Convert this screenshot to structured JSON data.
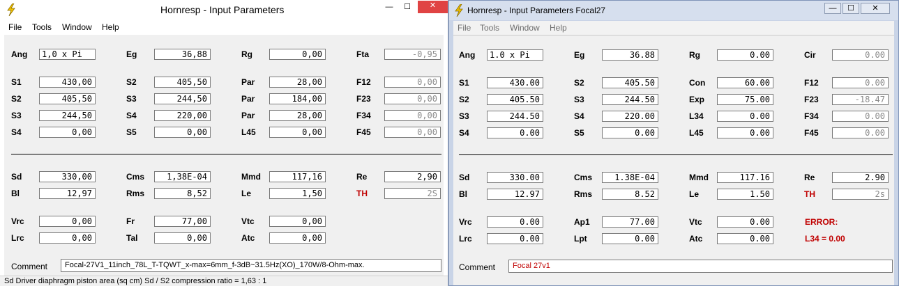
{
  "w1": {
    "title": "Hornresp - Input Parameters",
    "menu": [
      "File",
      "Tools",
      "Window",
      "Help"
    ],
    "captions": {
      "min": "—",
      "max": "☐",
      "close": "✕"
    },
    "fields": {
      "Ang": "1,0 x Pi",
      "Eg": "36,88",
      "Rg": "0,00",
      "Fta": "-0,95",
      "S1a": "430,00",
      "S2b": "405,50",
      "Par1": "28,00",
      "F12": "0,00",
      "S2a": "405,50",
      "S3b": "244,50",
      "Par2": "184,00",
      "F23": "0,00",
      "S3a": "244,50",
      "S4b": "220,00",
      "Par3": "28,00",
      "F34": "0,00",
      "S4a": "0,00",
      "S5b": "0,00",
      "L45": "0,00",
      "F45": "0,00",
      "Sd": "330,00",
      "Cms": "1,38E-04",
      "Mmd": "117,16",
      "Re": "2,90",
      "Bl": "12,97",
      "Rms": "8,52",
      "Le": "1,50",
      "TH": "2S",
      "Vrc": "0,00",
      "Fr": "77,00",
      "Vtc": "0,00",
      "Lrc": "0,00",
      "Tal": "0,00",
      "Atc": "0,00"
    },
    "labels": {
      "Ang": "Ang",
      "Eg": "Eg",
      "Rg": "Rg",
      "Fta": "Fta",
      "S1a": "S1",
      "S2b": "S2",
      "Par1": "Par",
      "F12": "F12",
      "S2a": "S2",
      "S3b": "S3",
      "Par2": "Par",
      "F23": "F23",
      "S3a": "S3",
      "S4b": "S4",
      "Par3": "Par",
      "F34": "F34",
      "S4a": "S4",
      "S5b": "S5",
      "L45": "L45",
      "F45": "F45",
      "Sd": "Sd",
      "Cms": "Cms",
      "Mmd": "Mmd",
      "Re": "Re",
      "Bl": "Bl",
      "Rms": "Rms",
      "Le": "Le",
      "TH": "TH",
      "Vrc": "Vrc",
      "Fr": "Fr",
      "Vtc": "Vtc",
      "Lrc": "Lrc",
      "Tal": "Tal",
      "Atc": "Atc"
    },
    "comment_label": "Comment",
    "comment": "Focal-27V1_11inch_78L_T-TQWT_x-max=6mm_f-3dB~31.5Hz(XO)_170W/8-Ohm-max.",
    "status": "Sd   Driver diaphragm piston area  (sq cm)   Sd / S2 compression ratio = 1,63 : 1"
  },
  "w2": {
    "title": "Hornresp - Input Parameters   Focal27",
    "menu": [
      "File",
      "Tools",
      "Window",
      "Help"
    ],
    "captions": {
      "min": "—",
      "max": "☐",
      "close": "✕"
    },
    "fields": {
      "Ang": "1.0 x Pi",
      "Eg": "36.88",
      "Rg": "0.00",
      "Cir": "0.00",
      "S1a": "430.00",
      "S2b": "405.50",
      "Con": "60.00",
      "F12": "0.00",
      "S2a": "405.50",
      "S3b": "244.50",
      "Exp": "75.00",
      "F23": "-18.47",
      "S3a": "244.50",
      "S4b": "220.00",
      "L34": "0.00",
      "F34": "0.00",
      "S4a": "0.00",
      "S5b": "0.00",
      "L45": "0.00",
      "F45": "0.00",
      "Sd": "330.00",
      "Cms": "1.38E-04",
      "Mmd": "117.16",
      "Re": "2.90",
      "Bl": "12.97",
      "Rms": "8.52",
      "Le": "1.50",
      "TH": "2s",
      "Vrc": "0.00",
      "Ap1": "77.00",
      "Vtc": "0.00",
      "Lrc": "0.00",
      "Lpt": "0.00",
      "Atc": "0.00"
    },
    "labels": {
      "Ang": "Ang",
      "Eg": "Eg",
      "Rg": "Rg",
      "Cir": "Cir",
      "S1a": "S1",
      "S2b": "S2",
      "Con": "Con",
      "F12": "F12",
      "S2a": "S2",
      "S3b": "S3",
      "Exp": "Exp",
      "F23": "F23",
      "S3a": "S3",
      "S4b": "S4",
      "L34": "L34",
      "F34": "F34",
      "S4a": "S4",
      "S5b": "S5",
      "L45": "L45",
      "F45": "F45",
      "Sd": "Sd",
      "Cms": "Cms",
      "Mmd": "Mmd",
      "Re": "Re",
      "Bl": "Bl",
      "Rms": "Rms",
      "Le": "Le",
      "TH": "TH",
      "Vrc": "Vrc",
      "Ap1": "Ap1",
      "Vtc": "Vtc",
      "Lrc": "Lrc",
      "Lpt": "Lpt",
      "Atc": "Atc"
    },
    "error_title": "ERROR:",
    "error_msg": "L34 = 0.00",
    "comment_label": "Comment",
    "comment": "Focal 27v1"
  },
  "colors": {
    "error": "#c00000",
    "disabled_text": "#8a8a8a",
    "accent_bolt": "#f2c200"
  }
}
